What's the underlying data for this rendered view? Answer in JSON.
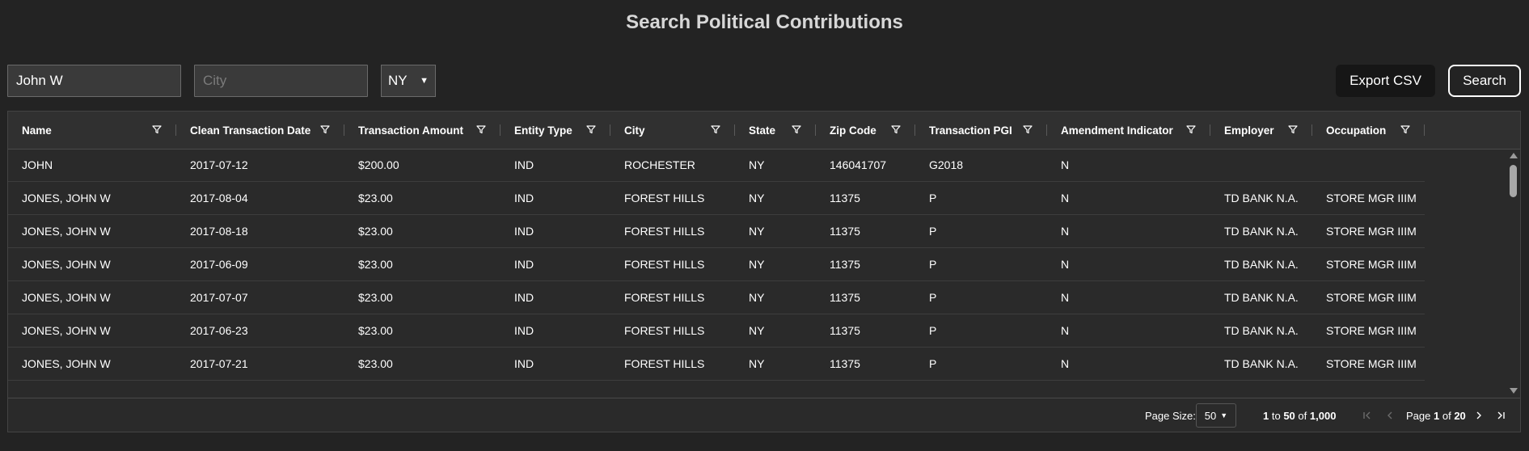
{
  "page": {
    "title": "Search Political Contributions"
  },
  "search": {
    "name_value": "John W",
    "city_placeholder": "City",
    "city_value": "",
    "state_selected": "NY",
    "export_label": "Export CSV",
    "search_label": "Search"
  },
  "table": {
    "columns": [
      "Name",
      "Clean Transaction Date",
      "Transaction Amount",
      "Entity Type",
      "City",
      "State",
      "Zip Code",
      "Transaction PGI",
      "Amendment Indicator",
      "Employer",
      "Occupation"
    ],
    "rows": [
      [
        "JOHN",
        "2017-07-12",
        "$200.00",
        "IND",
        "ROCHESTER",
        "NY",
        "146041707",
        "G2018",
        "N",
        "",
        ""
      ],
      [
        "JONES, JOHN W",
        "2017-08-04",
        "$23.00",
        "IND",
        "FOREST HILLS",
        "NY",
        "11375",
        "P",
        "N",
        "TD BANK N.A.",
        "STORE MGR IIIM"
      ],
      [
        "JONES, JOHN W",
        "2017-08-18",
        "$23.00",
        "IND",
        "FOREST HILLS",
        "NY",
        "11375",
        "P",
        "N",
        "TD BANK N.A.",
        "STORE MGR IIIM"
      ],
      [
        "JONES, JOHN W",
        "2017-06-09",
        "$23.00",
        "IND",
        "FOREST HILLS",
        "NY",
        "11375",
        "P",
        "N",
        "TD BANK N.A.",
        "STORE MGR IIIM"
      ],
      [
        "JONES, JOHN W",
        "2017-07-07",
        "$23.00",
        "IND",
        "FOREST HILLS",
        "NY",
        "11375",
        "P",
        "N",
        "TD BANK N.A.",
        "STORE MGR IIIM"
      ],
      [
        "JONES, JOHN W",
        "2017-06-23",
        "$23.00",
        "IND",
        "FOREST HILLS",
        "NY",
        "11375",
        "P",
        "N",
        "TD BANK N.A.",
        "STORE MGR IIIM"
      ],
      [
        "JONES, JOHN W",
        "2017-07-21",
        "$23.00",
        "IND",
        "FOREST HILLS",
        "NY",
        "11375",
        "P",
        "N",
        "TD BANK N.A.",
        "STORE MGR IIIM"
      ]
    ]
  },
  "footer": {
    "page_size_label": "Page Size:",
    "page_size_value": "50",
    "range_from": "1",
    "range_to_word": "to",
    "range_to": "50",
    "range_of_word": "of",
    "range_total": "1,000",
    "page_word": "Page",
    "page_current": "1",
    "page_of_word": "of",
    "page_total": "20"
  },
  "icons": {
    "filter": "filter-icon",
    "first_page": "first-page-icon",
    "prev_page": "previous-page-icon",
    "next_page": "next-page-icon",
    "last_page": "last-page-icon"
  },
  "colors": {
    "background": "#232323",
    "header_bg": "#303030",
    "grid_bg": "#2a2a2a",
    "title": "#d7d7d7",
    "disabled_icon": "#6b6b6b"
  }
}
